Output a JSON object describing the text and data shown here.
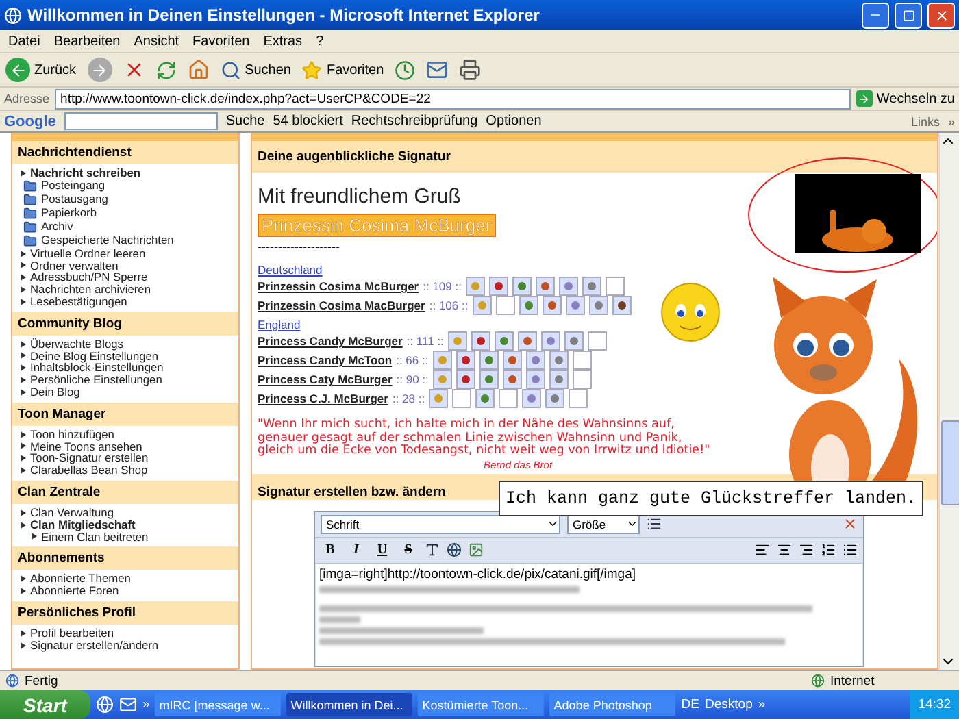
{
  "window": {
    "title": "Willkommen in Deinen Einstellungen - Microsoft Internet Explorer"
  },
  "menu": [
    "Datei",
    "Bearbeiten",
    "Ansicht",
    "Favoriten",
    "Extras",
    "?"
  ],
  "toolbar": {
    "back": "Zurück",
    "search": "Suchen",
    "favorites": "Favoriten"
  },
  "address": {
    "label": "Adresse",
    "value": "http://www.toontown-click.de/index.php?act=UserCP&CODE=22",
    "go": "Wechseln zu"
  },
  "google_bar": {
    "logo": "Google",
    "search": "Suche",
    "blocked": "54 blockiert",
    "spelling": "Rechtschreibprüfung",
    "options": "Optionen",
    "links": "Links",
    "more": "»"
  },
  "sidebar": {
    "sections": [
      {
        "title": "Nachrichtendienst",
        "items": [
          {
            "label": "Nachricht schreiben",
            "kind": "bullet",
            "children": [
              {
                "label": "Posteingang",
                "kind": "folder"
              },
              {
                "label": "Postausgang",
                "kind": "folder"
              },
              {
                "label": "Papierkorb",
                "kind": "folder"
              },
              {
                "label": "Archiv",
                "kind": "folder"
              },
              {
                "label": "Gespeicherte Nachrichten",
                "kind": "folder"
              }
            ]
          },
          {
            "label": "Virtuelle Ordner leeren",
            "kind": "bullet"
          },
          {
            "label": "Ordner verwalten",
            "kind": "bullet"
          },
          {
            "label": "Adressbuch/PN Sperre",
            "kind": "bullet"
          },
          {
            "label": "Nachrichten archivieren",
            "kind": "bullet"
          },
          {
            "label": "Lesebestätigungen",
            "kind": "bullet"
          }
        ]
      },
      {
        "title": "Community Blog",
        "items": [
          {
            "label": "Überwachte Blogs",
            "kind": "bullet"
          },
          {
            "label": "Deine Blog Einstellungen",
            "kind": "bullet"
          },
          {
            "label": "Inhaltsblock-Einstellungen",
            "kind": "bullet"
          },
          {
            "label": "Persönliche Einstellungen",
            "kind": "bullet"
          },
          {
            "label": "Dein Blog",
            "kind": "bullet"
          }
        ]
      },
      {
        "title": "Toon Manager",
        "items": [
          {
            "label": "Toon hinzufügen",
            "kind": "bullet"
          },
          {
            "label": "Meine Toons ansehen",
            "kind": "bullet"
          },
          {
            "label": "Toon-Signatur erstellen",
            "kind": "bullet"
          },
          {
            "label": "Clarabellas Bean Shop",
            "kind": "bullet"
          }
        ]
      },
      {
        "title": "Clan Zentrale",
        "items": [
          {
            "label": "Clan Verwaltung",
            "kind": "bullet"
          },
          {
            "label": "Clan Mitgliedschaft",
            "kind": "bullet",
            "children": [
              {
                "label": "Einem Clan beitreten",
                "kind": "bullet"
              }
            ]
          }
        ]
      },
      {
        "title": "Abonnements",
        "items": [
          {
            "label": "Abonnierte Themen",
            "kind": "bullet"
          },
          {
            "label": "Abonnierte Foren",
            "kind": "bullet"
          }
        ]
      },
      {
        "title": "Persönliches Profil",
        "items": [
          {
            "label": "Profil bearbeiten",
            "kind": "bullet"
          },
          {
            "label": "Signatur erstellen/ändern",
            "kind": "bullet"
          }
        ]
      }
    ]
  },
  "signature": {
    "header": "Deine augenblickliche Signatur",
    "greeting": "Mit freundlichem Gruß",
    "name_banner": "Prinzessin Cosima McBurger",
    "dashes": "--------------------",
    "groups": [
      {
        "country": "Deutschland",
        "toons": [
          {
            "name": "Prinzessin Cosima McBurger",
            "score": ":: 109 ::",
            "slots": [
              {
                "filled": true
              },
              {
                "filled": true
              },
              {
                "filled": true
              },
              {
                "filled": true
              },
              {
                "filled": true
              },
              {
                "filled": true
              },
              {
                "filled": false
              }
            ]
          },
          {
            "name": "Prinzessin Cosima MacBurger",
            "score": ":: 106 ::",
            "slots": [
              {
                "filled": true
              },
              {
                "filled": false
              },
              {
                "filled": true
              },
              {
                "filled": true
              },
              {
                "filled": true
              },
              {
                "filled": true
              },
              {
                "filled": true
              }
            ]
          }
        ]
      },
      {
        "country": "England",
        "toons": [
          {
            "name": "Princess Candy McBurger",
            "score": ":: 111 ::",
            "slots": [
              {
                "filled": true
              },
              {
                "filled": true
              },
              {
                "filled": true
              },
              {
                "filled": true
              },
              {
                "filled": true
              },
              {
                "filled": true
              },
              {
                "filled": false
              }
            ]
          },
          {
            "name": "Princess Candy McToon",
            "score": ":: 66 ::",
            "slots": [
              {
                "filled": true
              },
              {
                "filled": true
              },
              {
                "filled": true
              },
              {
                "filled": true
              },
              {
                "filled": true
              },
              {
                "filled": true
              },
              {
                "filled": false
              }
            ]
          },
          {
            "name": "Princess Caty McBurger",
            "score": ":: 90 ::",
            "slots": [
              {
                "filled": true
              },
              {
                "filled": true
              },
              {
                "filled": true
              },
              {
                "filled": true
              },
              {
                "filled": true
              },
              {
                "filled": true
              },
              {
                "filled": false
              }
            ]
          },
          {
            "name": "Princess C.J. McBurger",
            "score": ":: 28 ::",
            "slots": [
              {
                "filled": true
              },
              {
                "filled": false
              },
              {
                "filled": true
              },
              {
                "filled": false
              },
              {
                "filled": true
              },
              {
                "filled": true
              },
              {
                "filled": false
              }
            ]
          }
        ]
      }
    ],
    "quote": "\"Wenn Ihr mich sucht, ich halte mich in der Nähe des Wahnsinns auf,\ngenauer gesagt auf der schmalen Linie zwischen Wahnsinn und Panik,\ngleich um die Ecke von Todesangst, nicht weit weg von Irrwitz und Idiotie!\"",
    "quote_author": "Bernd das Brot"
  },
  "caption": "Ich kann ganz gute Glückstreffer landen.",
  "editor": {
    "header": "Signatur erstellen bzw. ändern",
    "font": "Schrift",
    "size": "Größe",
    "format_buttons": [
      "B",
      "I",
      "U",
      "S"
    ],
    "text": "[imga=right]http://toontown-click.de/pix/catani.gif[/imga]"
  },
  "status_bar": {
    "text": "Fertig",
    "zone": "Internet"
  },
  "taskbar": {
    "start": "Start",
    "more": "»",
    "tasks": [
      {
        "label": "mIRC [message w...",
        "selected": false
      },
      {
        "label": "Willkommen in Dei...",
        "selected": true
      },
      {
        "label": "Kostümierte Toon...",
        "selected": false
      },
      {
        "label": "Adobe Photoshop",
        "selected": false
      }
    ],
    "language": "DE",
    "desktop": "Desktop",
    "desktop_more": "»",
    "clock": "14:32"
  }
}
